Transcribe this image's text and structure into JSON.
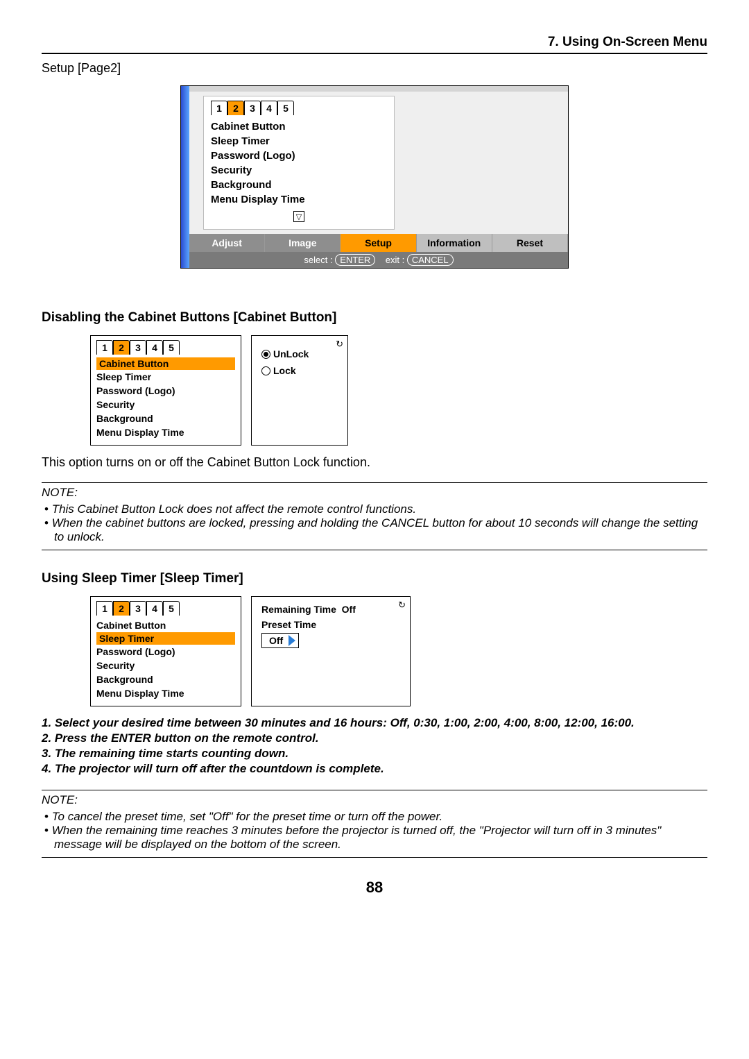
{
  "header": {
    "section": "7. Using On-Screen Menu"
  },
  "setupLabel": "Setup [Page2]",
  "mainShot": {
    "pages": [
      "1",
      "2",
      "3",
      "4",
      "5"
    ],
    "activePage": "2",
    "items": [
      "Cabinet Button",
      "Sleep Timer",
      "Password (Logo)",
      "Security",
      "Background",
      "Menu Display Time"
    ],
    "bottomTabs": {
      "adjust": "Adjust",
      "image": "Image",
      "setup": "Setup",
      "info": "Information",
      "reset": "Reset"
    },
    "selectBar": {
      "selectLabel": "select :",
      "selectKey": "ENTER",
      "exitLabel": "exit :",
      "exitKey": "CANCEL"
    }
  },
  "cabinet": {
    "heading": "Disabling the Cabinet Buttons [Cabinet Button]",
    "left": {
      "pages": [
        "1",
        "2",
        "3",
        "4",
        "5"
      ],
      "activePage": "2",
      "items": [
        "Cabinet Button",
        "Sleep Timer",
        "Password (Logo)",
        "Security",
        "Background",
        "Menu Display Time"
      ],
      "highlight": "Cabinet Button"
    },
    "right": {
      "unlock": "UnLock",
      "lock": "Lock",
      "iconHint": "↻"
    },
    "desc": "This option turns on or off the Cabinet Button Lock function.",
    "noteLabel": "NOTE:",
    "notes": [
      "This Cabinet Button Lock does not affect the remote control functions.",
      "When the cabinet buttons are locked, pressing and holding the CANCEL button for about 10 seconds will change the setting to unlock."
    ]
  },
  "sleep": {
    "heading": "Using Sleep Timer [Sleep Timer]",
    "left": {
      "pages": [
        "1",
        "2",
        "3",
        "4",
        "5"
      ],
      "activePage": "2",
      "items": [
        "Cabinet Button",
        "Sleep Timer",
        "Password (Logo)",
        "Security",
        "Background",
        "Menu Display Time"
      ],
      "highlight": "Sleep Timer"
    },
    "right": {
      "remainingLabel": "Remaining Time",
      "remainingValue": "Off",
      "presetLabel": "Preset Time",
      "presetValue": "Off",
      "iconHint": "↻"
    },
    "steps": [
      "1. Select your desired time between 30 minutes and 16 hours: Off, 0:30, 1:00, 2:00, 4:00, 8:00, 12:00, 16:00.",
      "2. Press the ENTER button on the remote control.",
      "3. The remaining time starts counting down.",
      "4. The projector will turn off after the countdown is complete."
    ],
    "noteLabel": "NOTE:",
    "notes": [
      "To cancel the preset time, set \"Off\" for the preset time or turn off the power.",
      "When the remaining time reaches 3 minutes before the projector is turned off, the \"Projector will turn off in 3 minutes\" message will be displayed on the bottom of the screen."
    ]
  },
  "pageNumber": "88"
}
